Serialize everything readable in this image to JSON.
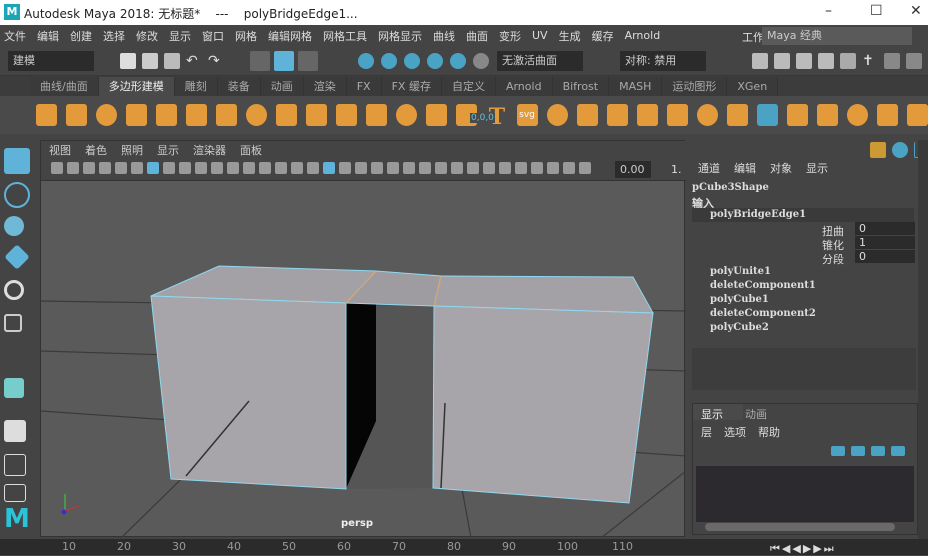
{
  "window": {
    "title": "Autodesk Maya 2018: 无标题*    ---    polyBridgeEdge1...",
    "logo": "M",
    "controls": [
      "–",
      "☐",
      "✕"
    ]
  },
  "menu": [
    "文件",
    "编辑",
    "创建",
    "选择",
    "修改",
    "显示",
    "窗口",
    "网格",
    "编辑网格",
    "网格工具",
    "网格显示",
    "曲线",
    "曲面",
    "变形",
    "UV",
    "生成",
    "缓存",
    "Arnold"
  ],
  "workspace": {
    "label": "工作区:",
    "value": "Maya 经典"
  },
  "status": {
    "mode": "建模",
    "curve": "无激活曲面",
    "symmetry": "对称: 禁用"
  },
  "shelf_tabs": [
    {
      "label": "曲线/曲面"
    },
    {
      "label": "多边形建模",
      "active": true
    },
    {
      "label": "雕刻"
    },
    {
      "label": "装备"
    },
    {
      "label": "动画"
    },
    {
      "label": "渲染"
    },
    {
      "label": "FX"
    },
    {
      "label": "FX 缓存"
    },
    {
      "label": "自定义"
    },
    {
      "label": "Arnold"
    },
    {
      "label": "Bifrost"
    },
    {
      "label": "MASH"
    },
    {
      "label": "运动图形"
    },
    {
      "label": "XGen"
    }
  ],
  "shelf_icon_text": {
    "text": "T",
    "svg": "svg",
    "count": "0,0,0"
  },
  "viewport": {
    "menu": [
      "视图",
      "着色",
      "照明",
      "显示",
      "渲染器",
      "面板"
    ],
    "field_value": "0.00",
    "field2": "1.",
    "camera": "persp"
  },
  "channel_box": {
    "menu": [
      "通道",
      "编辑",
      "对象",
      "显示"
    ],
    "node": "pCube3Shape",
    "inputs_label": "输入",
    "selected": "polyBridgeEdge1",
    "attributes": [
      {
        "name": "扭曲",
        "value": "0"
      },
      {
        "name": "锥化",
        "value": "1"
      },
      {
        "name": "分段",
        "value": "0"
      }
    ],
    "history": [
      "polyUnite1",
      "deleteComponent1",
      "polyCube1",
      "deleteComponent2",
      "polyCube2"
    ]
  },
  "layer_editor": {
    "tabs": [
      "显示",
      "动画"
    ],
    "menu": [
      "层",
      "选项",
      "帮助"
    ]
  },
  "timeline": {
    "ticks": [
      "10",
      "20",
      "30",
      "40",
      "50",
      "60",
      "70",
      "80",
      "90",
      "100",
      "110"
    ]
  },
  "colors": {
    "accent": "#5fb3d9",
    "shelf_orange": "#e39a3a",
    "selection_edge": "#8fd8f0"
  }
}
